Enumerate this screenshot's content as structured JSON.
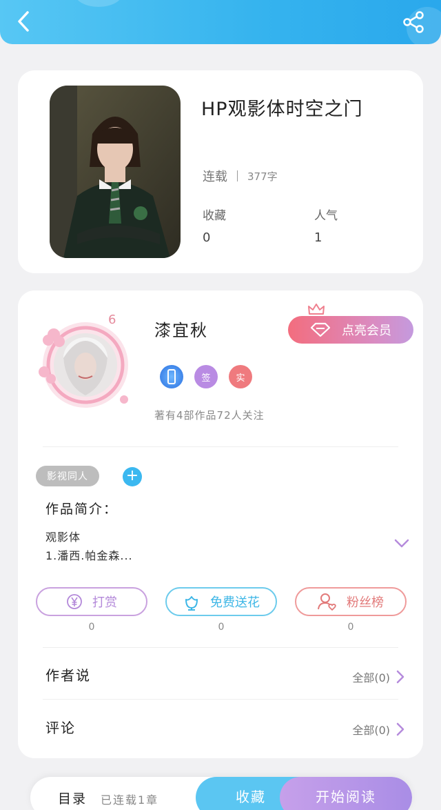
{
  "header": {
    "back_icon": "chevron-left-icon",
    "share_icon": "share-icon"
  },
  "book": {
    "title": "HP观影体时空之门",
    "status": "连载",
    "word_count": "377字",
    "favorites_label": "收藏",
    "favorites_value": "0",
    "popularity_label": "人气",
    "popularity_value": "1"
  },
  "author": {
    "name": "漆宜秋",
    "level": "6",
    "vip_button": "点亮会员",
    "badges": [
      "",
      "签",
      "实"
    ],
    "stats": "著有4部作品72人关注"
  },
  "tags": {
    "items": [
      "影视同人"
    ],
    "add_label": "+"
  },
  "intro": {
    "label": "作品简介：",
    "lines": [
      "观影体",
      "1.潘西.帕金森..."
    ]
  },
  "actions": [
    {
      "label": "打赏",
      "count": "0",
      "icon": "yen-icon"
    },
    {
      "label": "免费送花",
      "count": "0",
      "icon": "flower-icon"
    },
    {
      "label": "粉丝榜",
      "count": "0",
      "icon": "fan-user-icon"
    }
  ],
  "author_says": {
    "label": "作者说",
    "link": "全部(0)"
  },
  "comments": {
    "label": "评论",
    "link": "全部(0)"
  },
  "bottom_bar": {
    "toc_label": "目录",
    "chapter_info": "已连载1章",
    "collect_label": "收藏",
    "read_label": "开始阅读"
  },
  "colors": {
    "accent_blue": "#35b3ee",
    "accent_purple": "#b98be3",
    "accent_red": "#ef7a7e"
  }
}
